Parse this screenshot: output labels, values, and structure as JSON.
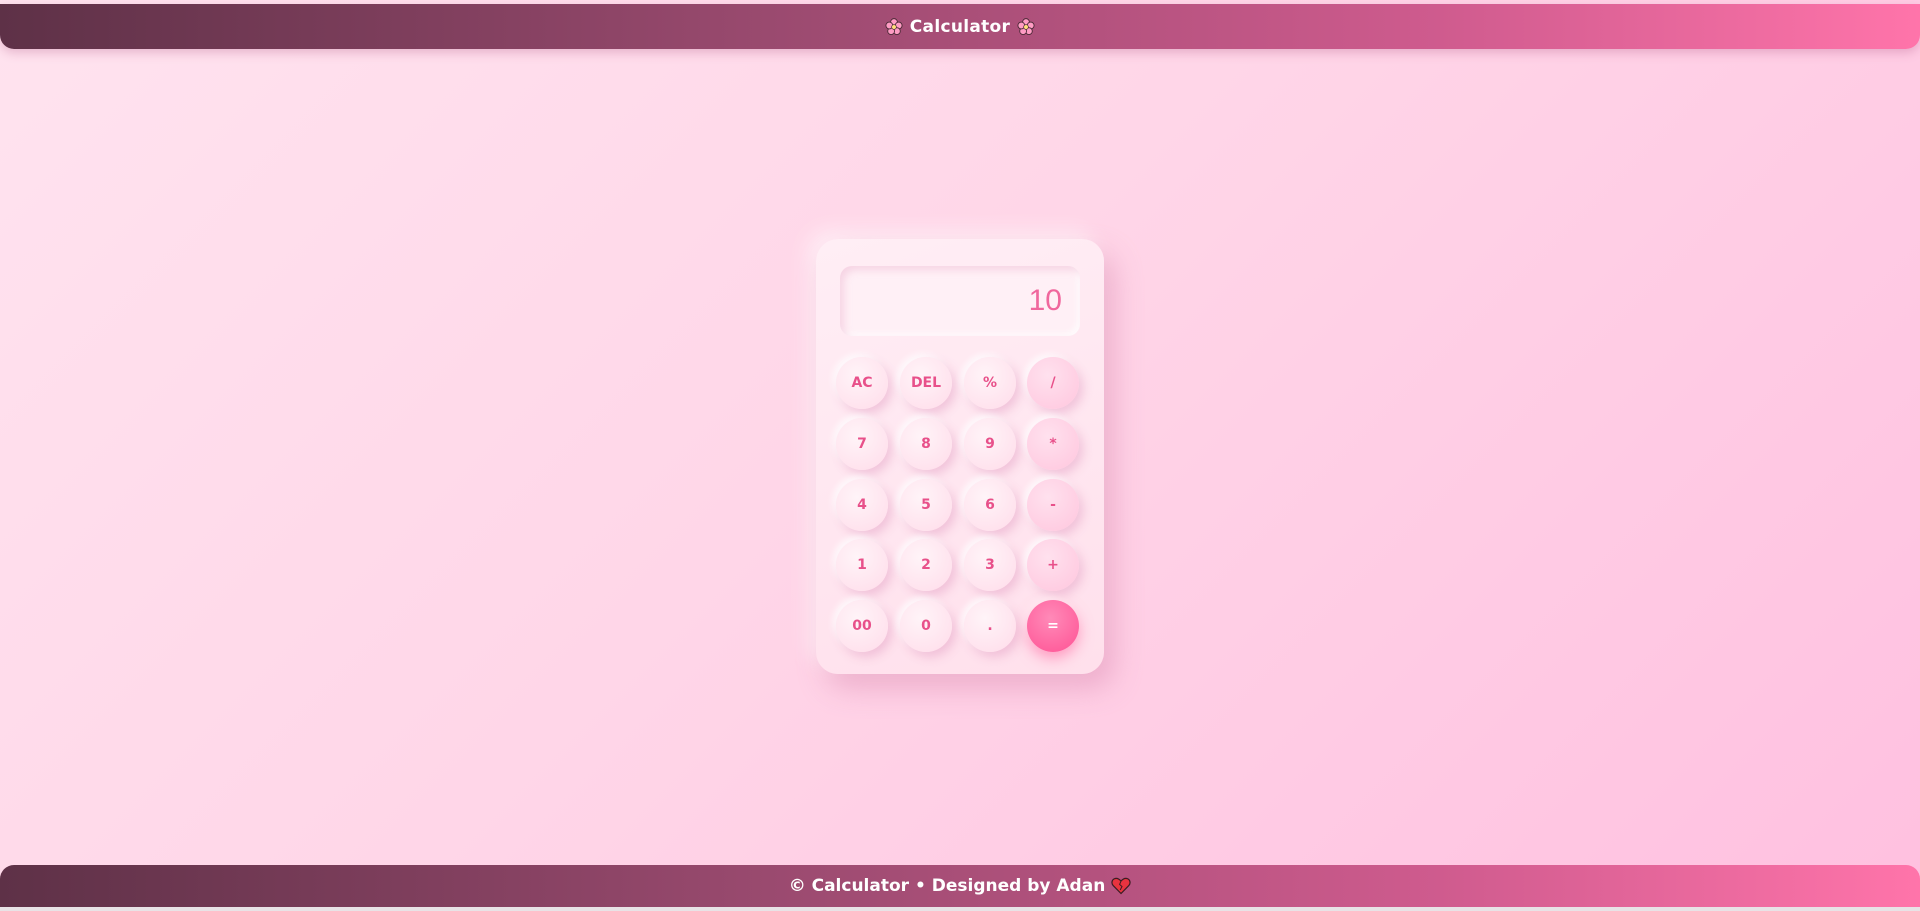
{
  "header": {
    "title": "Calculator",
    "left_icon": "flower-icon",
    "right_icon": "flower-icon"
  },
  "calculator": {
    "display_value": "10",
    "keys": {
      "ac": "AC",
      "del": "DEL",
      "percent": "%",
      "divide": "/",
      "seven": "7",
      "eight": "8",
      "nine": "9",
      "multiply": "*",
      "four": "4",
      "five": "5",
      "six": "6",
      "minus": "-",
      "one": "1",
      "two": "2",
      "three": "3",
      "plus": "+",
      "double_zero": "00",
      "zero": "0",
      "decimal": ".",
      "equals": "="
    }
  },
  "footer": {
    "text": "© Calculator • Designed by Adan",
    "icon": "heart-icon"
  },
  "colors": {
    "accent": "#ff5d9b",
    "key_text": "#e8508a",
    "header_start": "#5e3147",
    "header_end": "#ff74aa",
    "background": "#ffd6e8"
  }
}
